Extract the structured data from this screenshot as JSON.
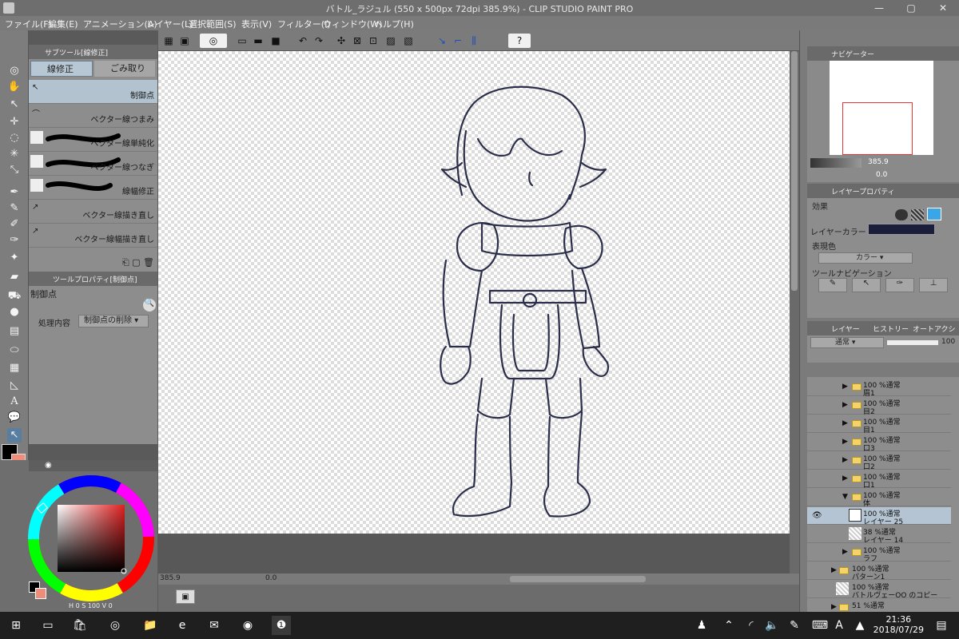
{
  "window": {
    "title": "バトル_ラジュル (550 x 500px 72dpi 385.9%)  - CLIP STUDIO PAINT PRO",
    "minimize": "—",
    "maximize": "▢",
    "close": "✕"
  },
  "menu": [
    "ファイル(F)",
    "編集(E)",
    "アニメーション(A)",
    "レイヤー(L)",
    "選択範囲(S)",
    "表示(V)",
    "フィルター(I)",
    "ウィンドウ(W)",
    "ヘルプ(H)"
  ],
  "subtool": {
    "header": "サブツール[線修正]",
    "tab_active": "線修正",
    "tab_other": "ごみ取り",
    "items": [
      "制御点",
      "ベクター線つまみ",
      "ベクター線単純化",
      "ベクター線つなぎ",
      "線幅修正",
      "ベクター線描き直し",
      "ベクター線幅描き直し"
    ]
  },
  "toolprop": {
    "header": "ツールプロパティ[制御点]",
    "tool_name": "制御点",
    "process_label": "処理内容",
    "process_value": "制御点の削除"
  },
  "color": {
    "main": "#000000",
    "sub": "#f08c7a",
    "indicator_values": [
      "0",
      "100",
      "0"
    ]
  },
  "canvas": {
    "line_color": "#2b2e4a"
  },
  "status": {
    "zoom": "385.9",
    "angle": "0.0"
  },
  "navigator": {
    "header": "ナビゲーター",
    "zoom": "385.9",
    "rotation": "0.0"
  },
  "layer_property": {
    "header": "レイヤープロパティ",
    "effect_label": "効果",
    "layer_color_label": "レイヤーカラー",
    "expression_color_label": "表現色",
    "expression_color_value": "カラー",
    "tool_nav_label": "ツールナビゲーション"
  },
  "layers": {
    "tab_layer": "レイヤー",
    "tab_history": "ヒストリー",
    "tab_auto": "オートアクション",
    "blend_mode": "通常",
    "opacity": "100",
    "rows": [
      {
        "l1": "100 %通常",
        "l2": "眉1",
        "type": "folder"
      },
      {
        "l1": "100 %通常",
        "l2": "目2",
        "type": "folder"
      },
      {
        "l1": "100 %通常",
        "l2": "目1",
        "type": "folder"
      },
      {
        "l1": "100 %通常",
        "l2": "口3",
        "type": "folder"
      },
      {
        "l1": "100 %通常",
        "l2": "口2",
        "type": "folder"
      },
      {
        "l1": "100 %通常",
        "l2": "口1",
        "type": "folder"
      },
      {
        "l1": "100 %通常",
        "l2": "体",
        "type": "folder-open"
      },
      {
        "l1": "100 %通常",
        "l2": "レイヤー 25",
        "type": "layer-selected"
      },
      {
        "l1": "38 %通常",
        "l2": "レイヤー 14",
        "type": "layer"
      },
      {
        "l1": "100 %通常",
        "l2": "ラフ",
        "type": "folder"
      },
      {
        "l1": "100 %通常",
        "l2": "パターン1",
        "type": "folder"
      },
      {
        "l1": "100 %通常",
        "l2": "バトルヴェーOO のコピー",
        "type": "layer"
      },
      {
        "l1": "51 %通常",
        "l2": "",
        "type": "folder"
      }
    ]
  },
  "taskbar": {
    "time": "21:36",
    "date": "2018/07/29",
    "ime": "A"
  }
}
